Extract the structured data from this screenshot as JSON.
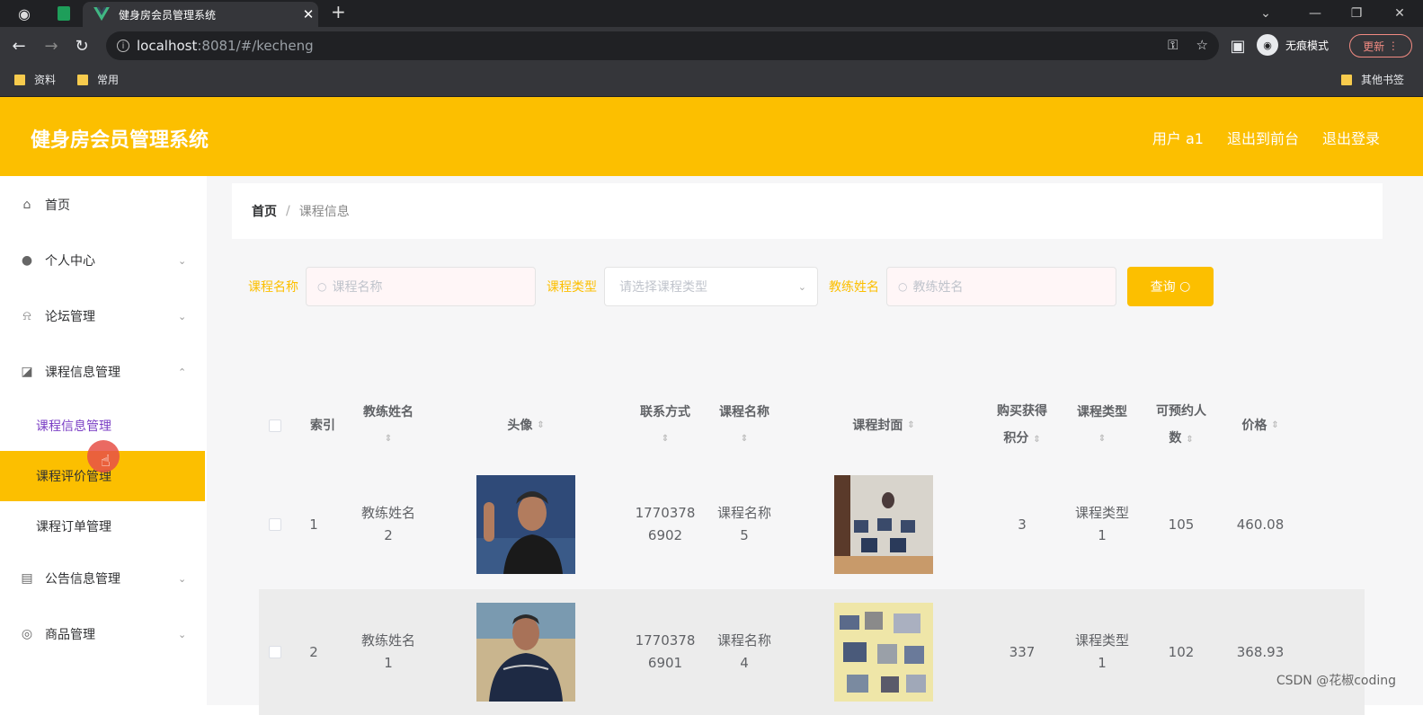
{
  "browser": {
    "tab_title": "健身房会员管理系统",
    "url_host": "localhost",
    "url_rest": ":8081/#/kecheng",
    "incognito_label": "无痕模式",
    "update_label": "更新",
    "bookmarks": [
      "资料",
      "常用"
    ],
    "other_bookmarks": "其他书签"
  },
  "app": {
    "title": "健身房会员管理系统",
    "user_label": "用户 a1",
    "back_to_front": "退出到前台",
    "logout": "退出登录"
  },
  "sidebar": {
    "items": [
      {
        "label": "首页",
        "icon": "home-icon"
      },
      {
        "label": "个人中心",
        "icon": "user-icon"
      },
      {
        "label": "论坛管理",
        "icon": "bell-icon"
      },
      {
        "label": "课程信息管理",
        "icon": "chart-icon"
      },
      {
        "label": "公告信息管理",
        "icon": "clipboard-icon"
      },
      {
        "label": "商品管理",
        "icon": "settings-icon"
      }
    ],
    "sub_items": [
      "课程信息管理",
      "课程评价管理",
      "课程订单管理"
    ]
  },
  "breadcrumb": {
    "home": "首页",
    "separator": "/",
    "current": "课程信息"
  },
  "search": {
    "course_name_label": "课程名称",
    "course_name_placeholder": "课程名称",
    "course_type_label": "课程类型",
    "course_type_placeholder": "请选择课程类型",
    "coach_name_label": "教练姓名",
    "coach_name_placeholder": "教练姓名",
    "query_label": "查询"
  },
  "table": {
    "headers": {
      "index": "索引",
      "coach_a": "教练姓名",
      "avatar": "头像",
      "contact": "联系方式",
      "course_name": "课程名称",
      "cover": "课程封面",
      "points_a": "购买获得",
      "points_b": "积分",
      "course_type": "课程类型",
      "capacity_a": "可预约人",
      "capacity_b": "数",
      "price": "价格"
    },
    "rows": [
      {
        "index": "1",
        "coach_a": "教练姓名",
        "coach_b": "2",
        "phone_a": "1770378",
        "phone_b": "6902",
        "course_a": "课程名称",
        "course_b": "5",
        "points": "3",
        "type_a": "课程类型",
        "type_b": "1",
        "capacity": "105",
        "price": "460.08"
      },
      {
        "index": "2",
        "coach_a": "教练姓名",
        "coach_b": "1",
        "phone_a": "1770378",
        "phone_b": "6901",
        "course_a": "课程名称",
        "course_b": "4",
        "points": "337",
        "type_a": "课程类型",
        "type_b": "1",
        "capacity": "102",
        "price": "368.93"
      }
    ]
  },
  "watermark": "CSDN @花椒coding"
}
